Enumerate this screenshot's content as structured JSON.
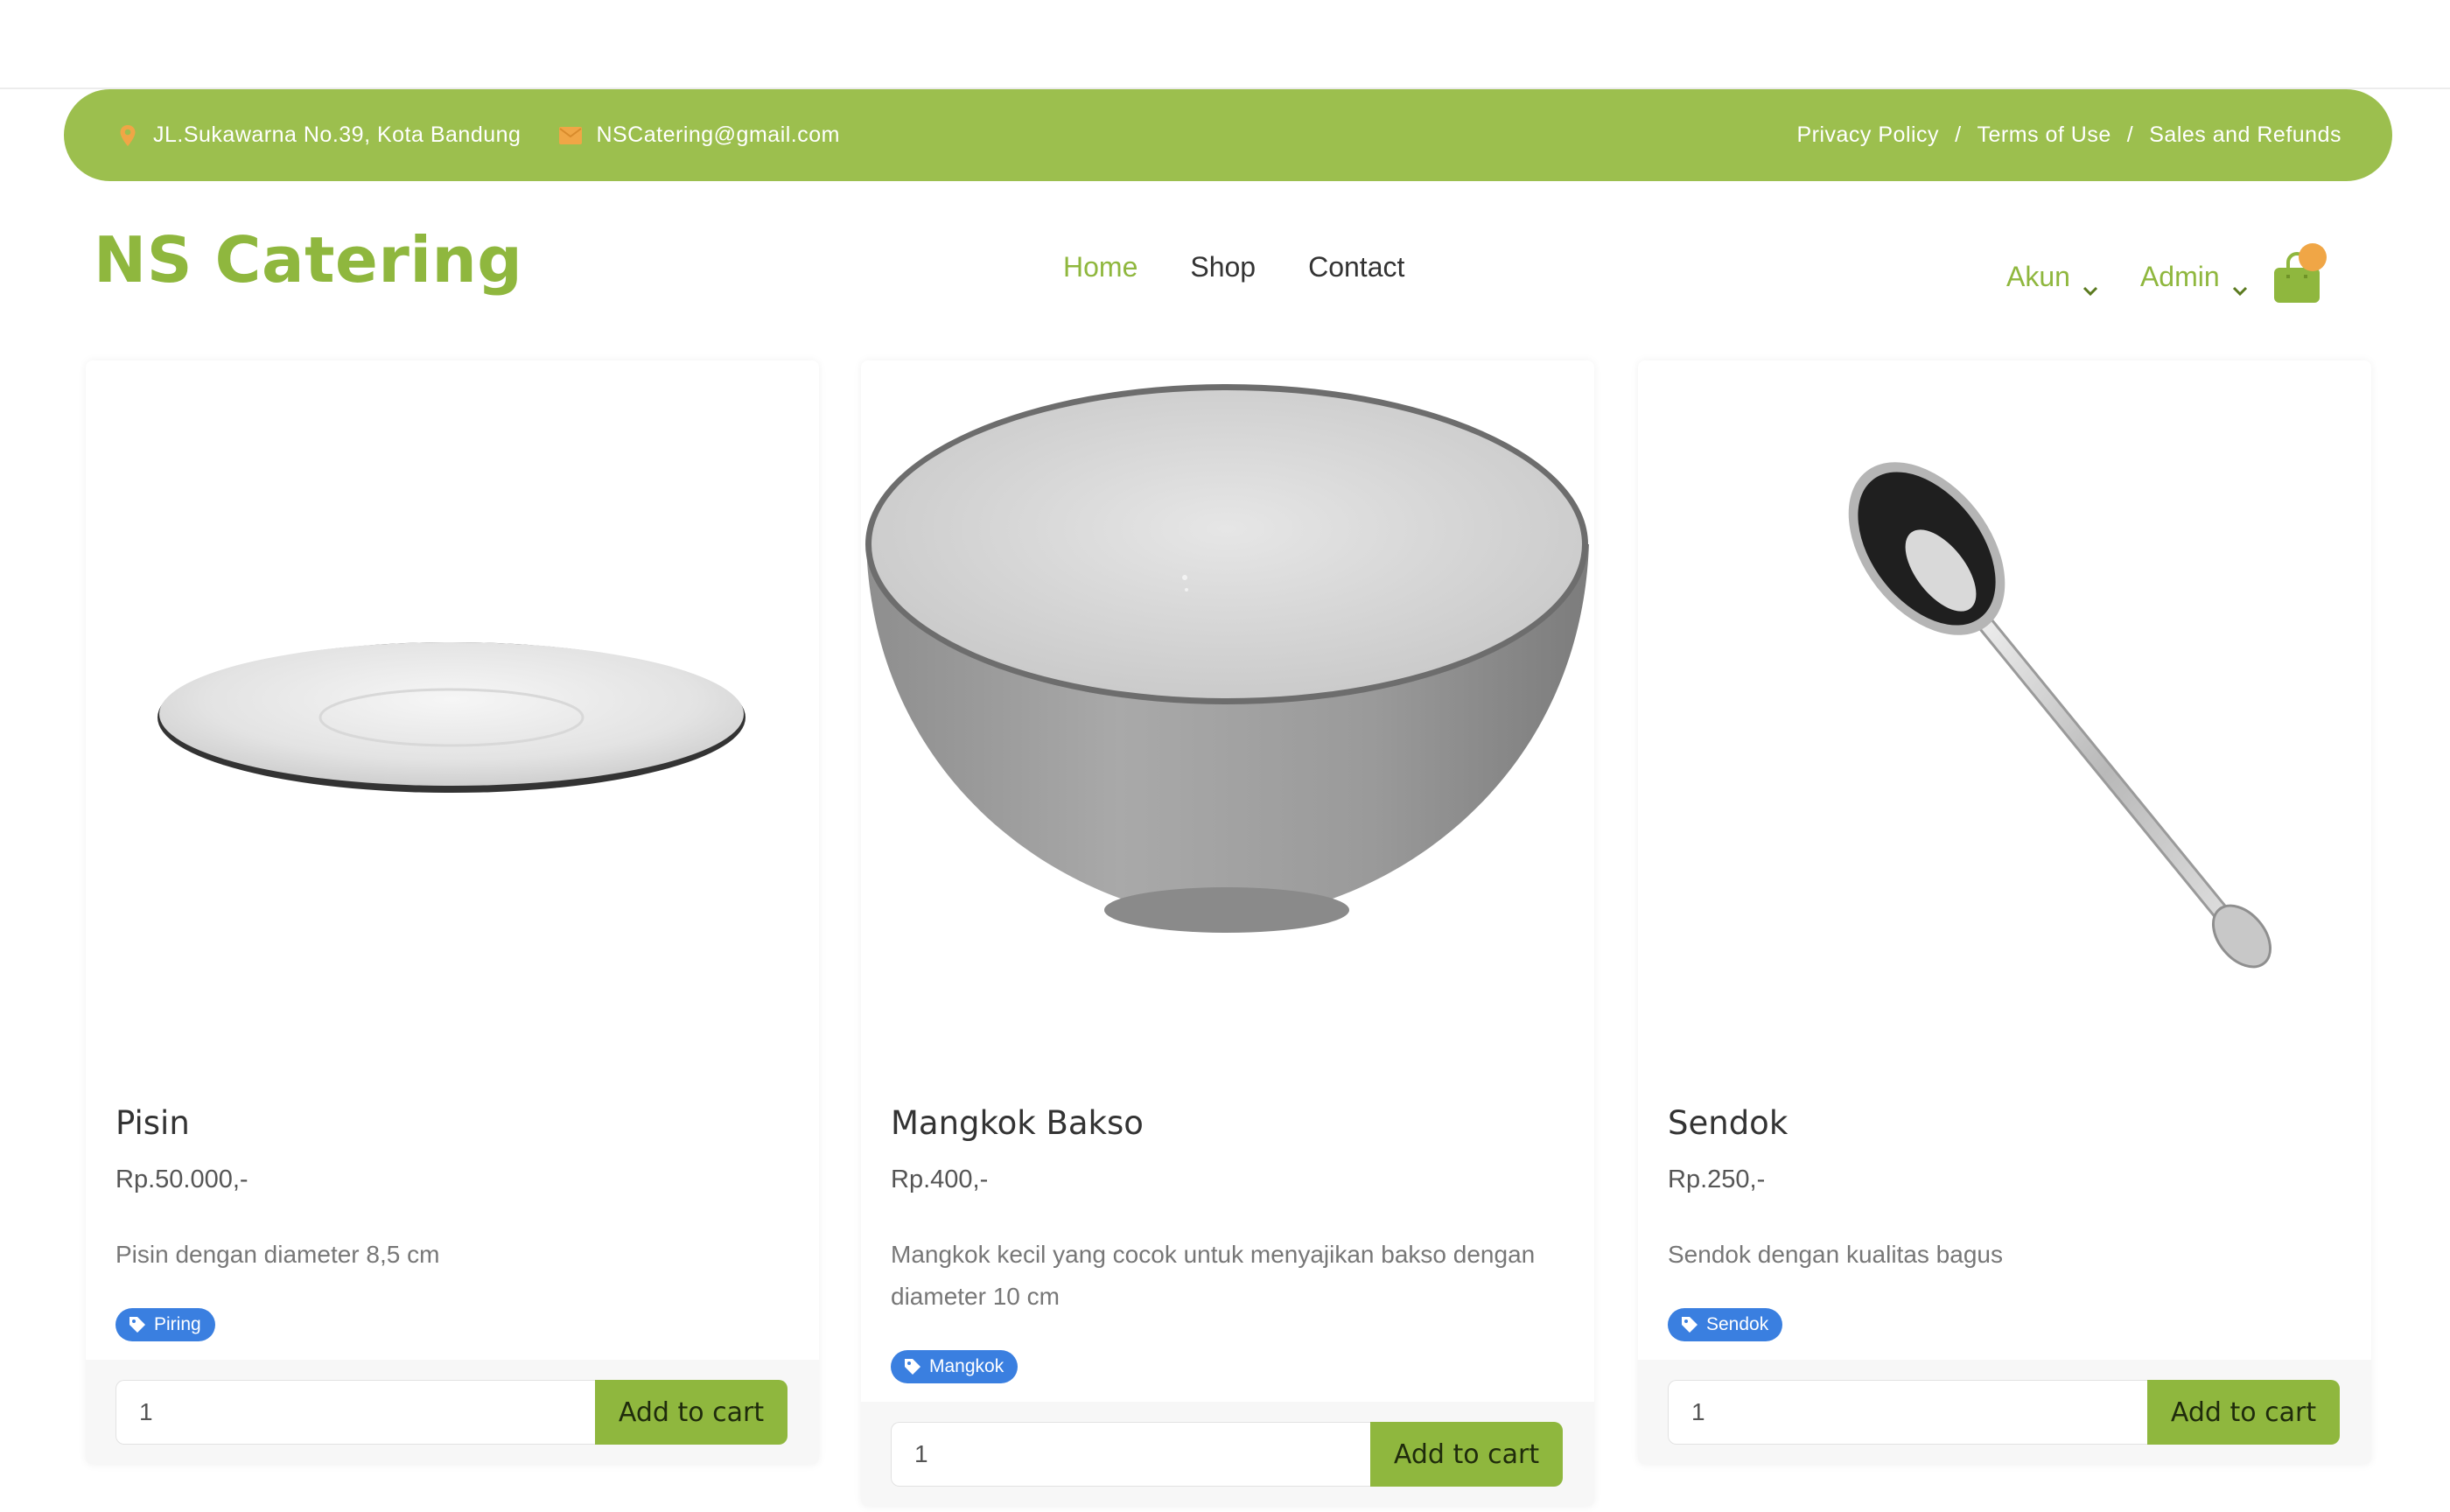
{
  "topbar": {
    "address": "JL.Sukawarna No.39, Kota Bandung",
    "email": "NSCatering@gmail.com",
    "links": [
      "Privacy Policy",
      "Terms of Use",
      "Sales and Refunds"
    ],
    "separator": "/",
    "address_icon": "map-pin-icon",
    "email_icon": "envelope-icon"
  },
  "brand": {
    "name": "NS Catering"
  },
  "nav": {
    "items": [
      "Home",
      "Shop",
      "Contact"
    ],
    "active": "Home"
  },
  "account": {
    "akun_label": "Akun",
    "admin_label": "Admin",
    "cart_icon": "shopping-bag-icon"
  },
  "products": [
    {
      "name": "Pisin",
      "price": "Rp.50.000,-",
      "description": "Pisin dengan diameter 8,5 cm",
      "tag": "Piring",
      "qty": "1",
      "button": "Add to cart"
    },
    {
      "name": "Mangkok Bakso",
      "price": "Rp.400,-",
      "description": "Mangkok kecil yang cocok untuk menyajikan bakso dengan diameter 10 cm",
      "tag": "Mangkok",
      "qty": "1",
      "button": "Add to cart"
    },
    {
      "name": "Sendok",
      "price": "Rp.250,-",
      "description": "Sendok dengan kualitas bagus",
      "tag": "Sendok",
      "qty": "1",
      "button": "Add to cart"
    }
  ],
  "colors": {
    "accent": "#9cbf4e",
    "brand": "#8fb73e",
    "tag": "#3a7fe0",
    "badge": "#f0a646"
  }
}
